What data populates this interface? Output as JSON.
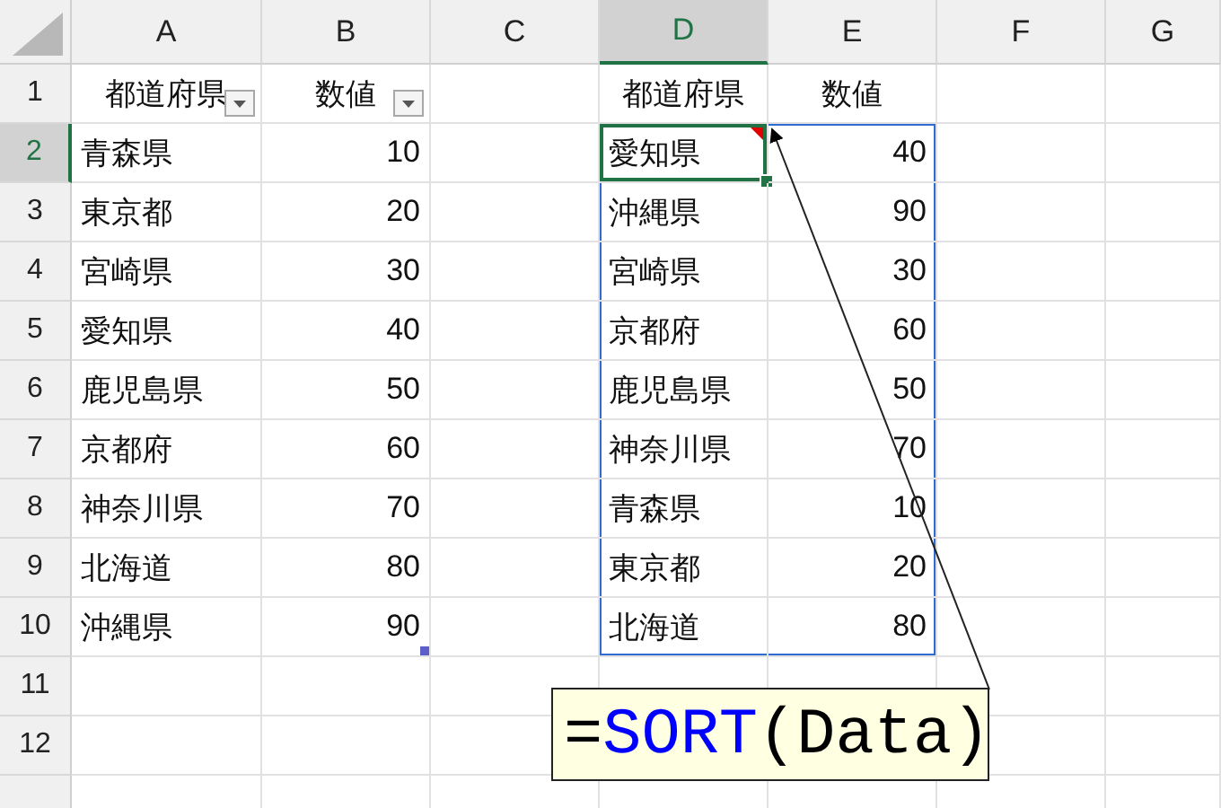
{
  "columns": [
    {
      "label": "A",
      "selected": false
    },
    {
      "label": "B",
      "selected": false
    },
    {
      "label": "C",
      "selected": false
    },
    {
      "label": "D",
      "selected": true
    },
    {
      "label": "E",
      "selected": false
    },
    {
      "label": "F",
      "selected": false
    },
    {
      "label": "G",
      "selected": false
    }
  ],
  "rows": [
    {
      "number": "1",
      "selected": false,
      "cells": [
        {
          "kind": "header",
          "text": "都道府県",
          "filter": true
        },
        {
          "kind": "header",
          "text": "数値",
          "filter": true
        },
        {
          "kind": "empty"
        },
        {
          "kind": "header",
          "text": "都道府県"
        },
        {
          "kind": "header",
          "text": "数値"
        },
        {
          "kind": "empty"
        },
        {
          "kind": "empty"
        }
      ]
    },
    {
      "number": "2",
      "selected": true,
      "cells": [
        {
          "kind": "text",
          "text": "青森県"
        },
        {
          "kind": "number",
          "text": "10"
        },
        {
          "kind": "empty"
        },
        {
          "kind": "text",
          "text": "愛知県",
          "spill": true,
          "note": true
        },
        {
          "kind": "number",
          "text": "40",
          "spill": true
        },
        {
          "kind": "empty"
        },
        {
          "kind": "empty"
        }
      ]
    },
    {
      "number": "3",
      "selected": false,
      "cells": [
        {
          "kind": "text",
          "text": "東京都"
        },
        {
          "kind": "number",
          "text": "20"
        },
        {
          "kind": "empty"
        },
        {
          "kind": "text",
          "text": "沖縄県",
          "spill": true
        },
        {
          "kind": "number",
          "text": "90",
          "spill": true
        },
        {
          "kind": "empty"
        },
        {
          "kind": "empty"
        }
      ]
    },
    {
      "number": "4",
      "selected": false,
      "cells": [
        {
          "kind": "text",
          "text": "宮崎県"
        },
        {
          "kind": "number",
          "text": "30"
        },
        {
          "kind": "empty"
        },
        {
          "kind": "text",
          "text": "宮崎県",
          "spill": true
        },
        {
          "kind": "number",
          "text": "30",
          "spill": true
        },
        {
          "kind": "empty"
        },
        {
          "kind": "empty"
        }
      ]
    },
    {
      "number": "5",
      "selected": false,
      "cells": [
        {
          "kind": "text",
          "text": "愛知県"
        },
        {
          "kind": "number",
          "text": "40"
        },
        {
          "kind": "empty"
        },
        {
          "kind": "text",
          "text": "京都府",
          "spill": true
        },
        {
          "kind": "number",
          "text": "60",
          "spill": true
        },
        {
          "kind": "empty"
        },
        {
          "kind": "empty"
        }
      ]
    },
    {
      "number": "6",
      "selected": false,
      "cells": [
        {
          "kind": "text",
          "text": "鹿児島県"
        },
        {
          "kind": "number",
          "text": "50"
        },
        {
          "kind": "empty"
        },
        {
          "kind": "text",
          "text": "鹿児島県",
          "spill": true
        },
        {
          "kind": "number",
          "text": "50",
          "spill": true
        },
        {
          "kind": "empty"
        },
        {
          "kind": "empty"
        }
      ]
    },
    {
      "number": "7",
      "selected": false,
      "cells": [
        {
          "kind": "text",
          "text": "京都府"
        },
        {
          "kind": "number",
          "text": "60"
        },
        {
          "kind": "empty"
        },
        {
          "kind": "text",
          "text": "神奈川県",
          "spill": true
        },
        {
          "kind": "number",
          "text": "70",
          "spill": true
        },
        {
          "kind": "empty"
        },
        {
          "kind": "empty"
        }
      ]
    },
    {
      "number": "8",
      "selected": false,
      "cells": [
        {
          "kind": "text",
          "text": "神奈川県"
        },
        {
          "kind": "number",
          "text": "70"
        },
        {
          "kind": "empty"
        },
        {
          "kind": "text",
          "text": "青森県",
          "spill": true
        },
        {
          "kind": "number",
          "text": "10",
          "spill": true
        },
        {
          "kind": "empty"
        },
        {
          "kind": "empty"
        }
      ]
    },
    {
      "number": "9",
      "selected": false,
      "cells": [
        {
          "kind": "text",
          "text": "北海道"
        },
        {
          "kind": "number",
          "text": "80"
        },
        {
          "kind": "empty"
        },
        {
          "kind": "text",
          "text": "東京都",
          "spill": true
        },
        {
          "kind": "number",
          "text": "20",
          "spill": true
        },
        {
          "kind": "empty"
        },
        {
          "kind": "empty"
        }
      ]
    },
    {
      "number": "10",
      "selected": false,
      "cells": [
        {
          "kind": "text",
          "text": "沖縄県"
        },
        {
          "kind": "number",
          "text": "90",
          "table_end": true
        },
        {
          "kind": "empty"
        },
        {
          "kind": "text",
          "text": "北海道",
          "spill": true
        },
        {
          "kind": "number",
          "text": "80",
          "spill": true
        },
        {
          "kind": "empty"
        },
        {
          "kind": "empty"
        }
      ]
    },
    {
      "number": "11",
      "selected": false,
      "cells": [
        {
          "kind": "empty"
        },
        {
          "kind": "empty"
        },
        {
          "kind": "empty"
        },
        {
          "kind": "empty"
        },
        {
          "kind": "empty"
        },
        {
          "kind": "empty"
        },
        {
          "kind": "empty"
        }
      ]
    },
    {
      "number": "12",
      "selected": false,
      "cells": [
        {
          "kind": "empty"
        },
        {
          "kind": "empty"
        },
        {
          "kind": "empty"
        },
        {
          "kind": "empty"
        },
        {
          "kind": "empty"
        },
        {
          "kind": "empty"
        },
        {
          "kind": "empty"
        }
      ]
    }
  ],
  "callout": {
    "parts": [
      {
        "text": "=",
        "color": "#000000"
      },
      {
        "text": "SORT",
        "color": "#0000ff"
      },
      {
        "text": "(Data)",
        "color": "#000000"
      }
    ]
  }
}
